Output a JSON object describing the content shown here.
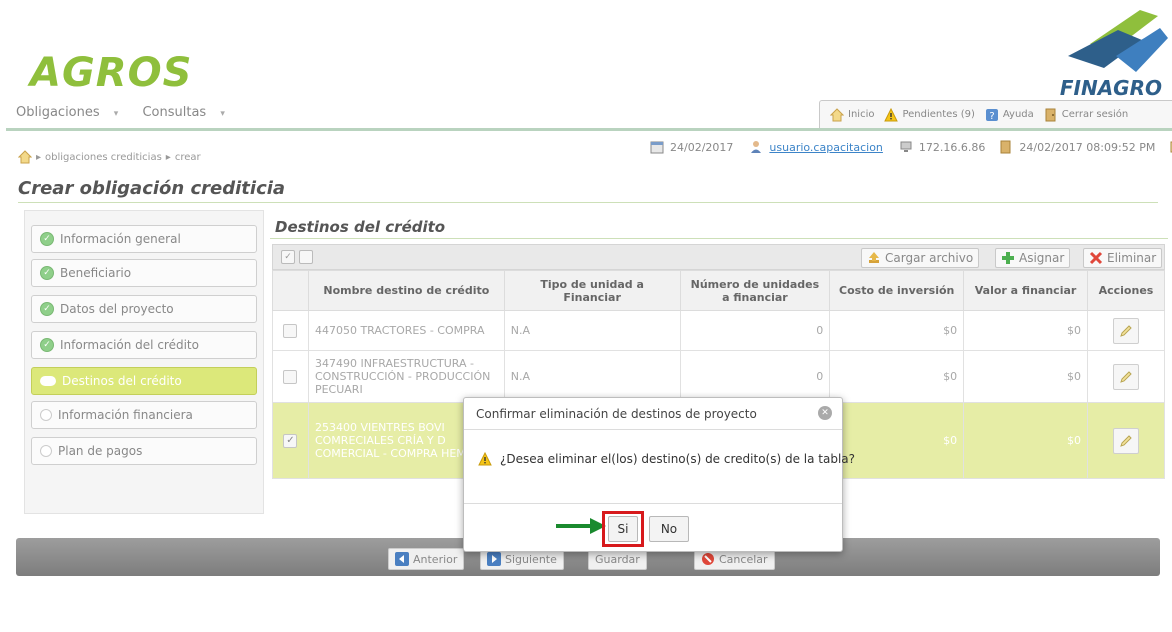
{
  "header": {
    "app_logo": "AGROS",
    "brand_logo": "FINAGRO",
    "menu": [
      {
        "label": "Obligaciones",
        "caret": "▾"
      },
      {
        "label": "Consultas",
        "caret": "▾"
      }
    ],
    "links": {
      "home": "Inicio",
      "pending": "Pendientes (9)",
      "help": "Ayuda",
      "logout": "Cerrar sesión"
    }
  },
  "breadcrumb": {
    "level1": "obligaciones crediticias",
    "level2": "crear"
  },
  "info": {
    "date": "24/02/2017",
    "user": "usuario.capacitacion",
    "ip": "172.16.6.86",
    "datetime": "24/02/2017 08:09:52 PM",
    "more": "..."
  },
  "page_title": "Crear obligación crediticia",
  "sidebar": {
    "items": [
      {
        "label": "Información general",
        "state": "done"
      },
      {
        "label": "Beneficiario",
        "state": "done"
      },
      {
        "label": "Datos del proyecto",
        "state": "done"
      },
      {
        "label": "Información del crédito",
        "state": "done"
      },
      {
        "label": "Destinos del crédito",
        "state": "active"
      },
      {
        "label": "Información financiera",
        "state": "pending"
      },
      {
        "label": "Plan de pagos",
        "state": "pending"
      }
    ]
  },
  "section": {
    "title": "Destinos del crédito",
    "toolbar": {
      "upload": "Cargar archivo",
      "assign": "Asignar",
      "delete": "Eliminar"
    },
    "columns": [
      "Nombre destino de crédito",
      "Tipo de unidad a Financiar",
      "Número de unidades a financiar",
      "Costo de inversión",
      "Valor a financiar",
      "Acciones"
    ],
    "rows": [
      {
        "name": "447050 TRACTORES - COMPRA",
        "unit_type": "N.A",
        "units": "0",
        "cost": "$0",
        "value": "$0",
        "checked": false
      },
      {
        "name": "347490 INFRAESTRUCTURA - CONSTRUCCIÓN - PRODUCCIÓN PECUARI",
        "unit_type": "N.A",
        "units": "0",
        "cost": "$0",
        "value": "$0",
        "checked": false
      },
      {
        "name": "253400 VIENTRES BOVI COMRECIALES CRÍA Y D COMERCIAL - COMPRA HEMBRA",
        "unit_type": "",
        "units": "",
        "cost": "$0",
        "value": "$0",
        "checked": true
      }
    ]
  },
  "footer": {
    "prev": "Anterior",
    "next": "Siguiente",
    "save": "Guardar",
    "cancel": "Cancelar"
  },
  "dialog": {
    "title": "Confirmar eliminación de destinos de proyecto",
    "message": "¿Desea eliminar el(los) destino(s) de credito(s) de la tabla?",
    "yes": "Si",
    "no": "No"
  },
  "colors": {
    "brand_green": "#8fbf3c",
    "brand_blue": "#2e5f8a",
    "selected_row": "#e6eda6",
    "active_step": "#dce87a",
    "highlight_red": "#d7191c",
    "arrow_green": "#1a8a2e"
  }
}
